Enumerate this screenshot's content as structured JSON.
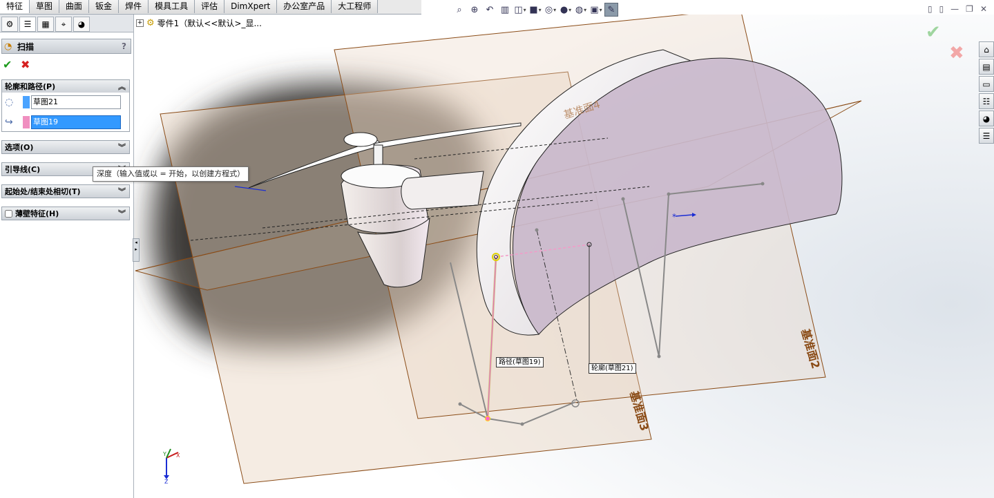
{
  "tabs": [
    "特征",
    "草图",
    "曲面",
    "钣金",
    "焊件",
    "模具工具",
    "评估",
    "DimXpert",
    "办公室产品",
    "大工程师"
  ],
  "active_tab": "特征",
  "hud_icons": [
    "zoom-to-fit-icon",
    "zoom-area-icon",
    "previous-view-icon",
    "section-view-icon",
    "view-orientation-icon",
    "display-style-icon",
    "hide-show-icon",
    "edit-appearance-icon",
    "apply-scene-icon",
    "view-settings-icon"
  ],
  "property_manager": {
    "title": "扫描",
    "help": "?",
    "groups": {
      "profile_path": {
        "label": "轮廓和路径(P)",
        "profile": "草图21",
        "path": "草图19",
        "profile_color": "#4aa3ff",
        "path_color": "#f08fc0"
      },
      "options": {
        "label": "选项(O)"
      },
      "guides": {
        "label": "引导线(C)"
      },
      "tangency": {
        "label": "起始处/结束处相切(T)"
      },
      "thin": {
        "label": "薄壁特征(H)"
      }
    }
  },
  "tooltip": "深度（输入值或以 = 开始，以创建方程式）",
  "tree": {
    "label": "零件1（默认<<默认>_显..."
  },
  "viewport": {
    "plane_labels": {
      "plane4": "基准面4",
      "plane2": "基准面2",
      "plane3": "基准面3"
    },
    "callouts": {
      "path": "路径(草图19)",
      "profile": "轮廓(草图21)"
    },
    "triad": {
      "x": "X",
      "y": "Y",
      "z": "Z"
    }
  },
  "colors": {
    "plane_edge": "#8a4b16",
    "plane_fill": "#e9d4c0",
    "body": "#c9b9cc",
    "selection_blue": "#3399ff"
  }
}
